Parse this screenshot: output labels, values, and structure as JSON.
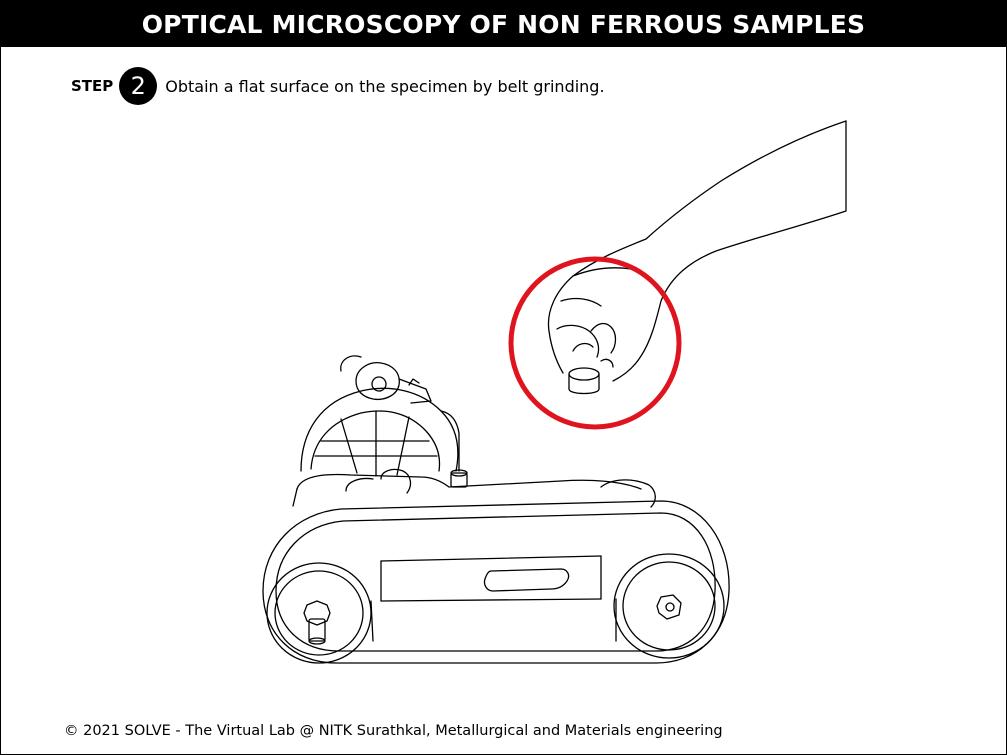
{
  "header": {
    "title": "OPTICAL MICROSCOPY OF NON FERROUS SAMPLES"
  },
  "step": {
    "label": "STEP",
    "number": "2",
    "instruction": "Obtain a flat surface on the specimen by belt grinding."
  },
  "illustration": {
    "highlight_color": "#e0141e",
    "line_color": "#000000"
  },
  "footer": {
    "copyright": "© 2021 SOLVE - The Virtual Lab @ NITK Surathkal, Metallurgical and Materials engineering"
  }
}
